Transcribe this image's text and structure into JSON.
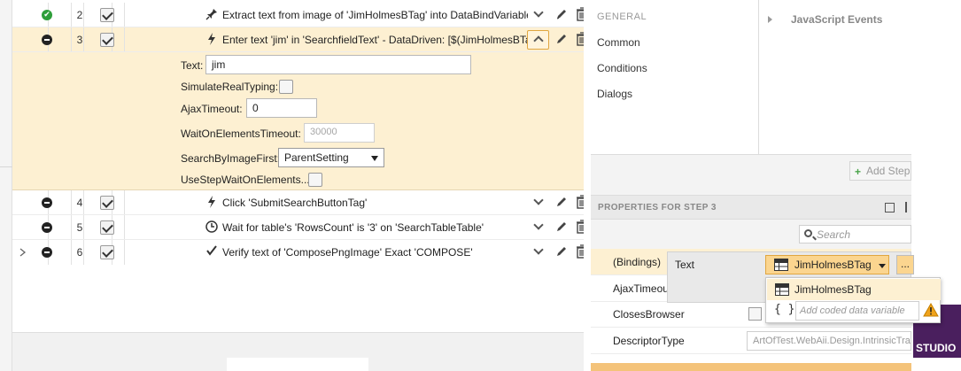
{
  "steps": [
    {
      "num": "2",
      "status": "ok",
      "icon": "pin-icon",
      "text": "Extract text from image of 'JimHolmesBTag' into DataBindVariable"
    },
    {
      "num": "3",
      "status": "blocked",
      "icon": "lightning-icon",
      "text": "Enter text 'jim' in 'SearchfieldText' - DataDriven: [$(JimHolmesBTag)]"
    },
    {
      "num": "4",
      "status": "blocked",
      "icon": "lightning-icon",
      "text": "Click 'SubmitSearchButtonTag'"
    },
    {
      "num": "5",
      "status": "blocked",
      "icon": "clock-icon",
      "text": "Wait for table's 'RowsCount' is '3' on 'SearchTableTable'"
    },
    {
      "num": "6",
      "status": "blocked",
      "icon": "check-icon",
      "text": "Verify text of 'ComposePngImage' Exact 'COMPOSE'"
    }
  ],
  "expanded": {
    "text_label": "Text:",
    "text_value": "jim",
    "simulate_label": "SimulateRealTyping:",
    "ajax_label": "AjaxTimeout:",
    "ajax_value": "0",
    "wait_label": "WaitOnElementsTimeout:",
    "wait_value": "30000",
    "search_label": "SearchByImageFirst:",
    "search_value": "ParentSetting",
    "usestep_label": "UseStepWaitOnElements..."
  },
  "nav": {
    "header": "GENERAL",
    "items": [
      "Common",
      "Conditions",
      "Dialogs"
    ],
    "js_events": "JavaScript Events"
  },
  "add_step": "Add Step",
  "properties": {
    "header": "PROPERTIES FOR STEP 3",
    "search_placeholder": "Search",
    "rows": [
      {
        "name": "(Bindings)"
      },
      {
        "name": "AjaxTimeout"
      },
      {
        "name": "ClosesBrowser"
      },
      {
        "name": "DescriptorType",
        "value": "ArtOfTest.WebAii.Design.IntrinsicTranslators"
      }
    ]
  },
  "bindings": {
    "field": "Text",
    "selected": "JimHolmesBTag",
    "more": "...",
    "options": [
      "JimHolmesBTag"
    ],
    "coded_placeholder": "Add coded data variable",
    "braces": "{ }"
  },
  "brand": "STUDIO",
  "colors": {
    "selected_row": "#fdf0d2",
    "accent": "#e0a640",
    "ok": "#2e9e3a",
    "brand": "#4a1f5e"
  }
}
